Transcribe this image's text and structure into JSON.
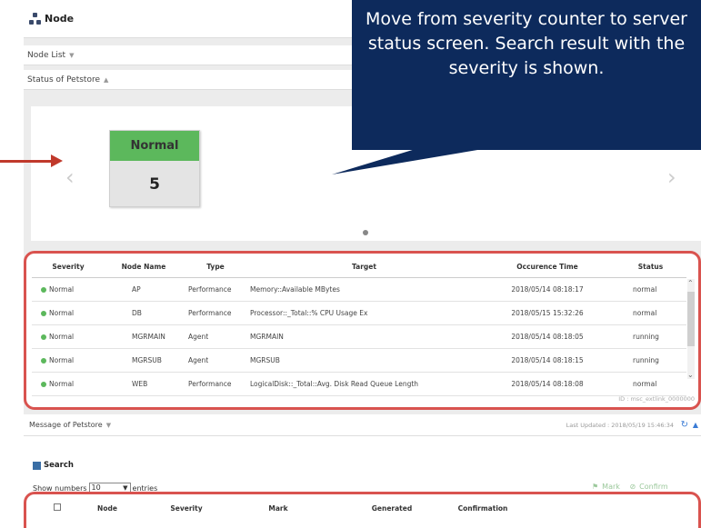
{
  "header": {
    "title": "Node"
  },
  "sections": {
    "node_list": "Node List",
    "status": "Status of Petstore"
  },
  "severity_card": {
    "label": "Normal",
    "count": "5"
  },
  "carousel": {
    "prev": "‹",
    "next": "›"
  },
  "status_table": {
    "columns": [
      "Severity",
      "Node Name",
      "Type",
      "Target",
      "Occurence Time",
      "Status"
    ],
    "rows": [
      [
        "Normal",
        "AP",
        "Performance",
        "Memory::Available MBytes",
        "2018/05/14 08:18:17",
        "normal"
      ],
      [
        "Normal",
        "DB",
        "Performance",
        "Processor::_Total::% CPU Usage Ex",
        "2018/05/15 15:32:26",
        "normal"
      ],
      [
        "Normal",
        "MGRMAIN",
        "Agent",
        "MGRMAIN",
        "2018/05/14 08:18:05",
        "running"
      ],
      [
        "Normal",
        "MGRSUB",
        "Agent",
        "MGRSUB",
        "2018/05/14 08:18:15",
        "running"
      ],
      [
        "Normal",
        "WEB",
        "Performance",
        "LogicalDisk::_Total::Avg. Disk Read Queue Length",
        "2018/05/14 08:18:08",
        "normal"
      ]
    ],
    "footer_id": "ID : msc_extlink_0000000"
  },
  "message": {
    "title": "Message of Petstore",
    "last_updated": "Last Updated : 2018/05/19 15:46:34",
    "search_label": "Search",
    "show_prefix": "Show numbers",
    "show_value": "10",
    "show_suffix": "entries",
    "mark_label": "Mark",
    "confirm_label": "Confirm",
    "columns": [
      "Node",
      "Severity",
      "Mark",
      "Generated",
      "Confirmation"
    ]
  },
  "callout": {
    "text": "Move from severity counter to server status screen. Search result with the severity is shown."
  },
  "colors": {
    "normal": "#5cb85c",
    "highlight": "#d9534f",
    "callout_bg": "#0d2a5c",
    "arrow": "#c0392b"
  },
  "icons": [
    "node-icon",
    "refresh-icon",
    "search-icon",
    "chevron-left-icon",
    "chevron-right-icon"
  ]
}
